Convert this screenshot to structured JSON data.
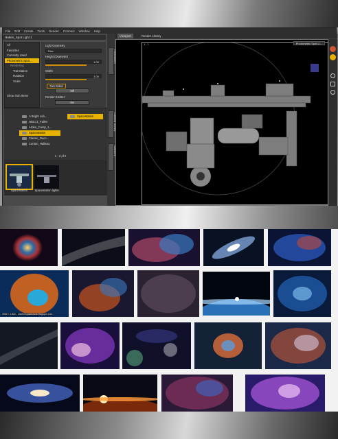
{
  "menu": [
    "File",
    "Edit",
    "Create",
    "Tools",
    "Render",
    "Connect",
    "Window",
    "Help"
  ],
  "left_panel": {
    "node_dropdown": "Hatten_Spot Light 1",
    "tree_items": [
      "All",
      "Favorites",
      "Currently Used",
      "Photometric Spot...",
      "Rendering",
      "Translation",
      "Rotation",
      "Scale",
      "Show Sub Items"
    ],
    "selected_tree_item": "Photometric Spot...",
    "properties": {
      "light_geometry_label": "Light Geometry",
      "light_geometry_value": "Disc",
      "height_label": "Height (Diameter)",
      "height_value": "1.00",
      "width_label": "Width",
      "width_value": "1.00",
      "two_sided_label": "Two Sided",
      "two_sided_value": "Off",
      "render_emitter_label": "Render Emitter",
      "render_emitter_value": "On"
    }
  },
  "side_tabs": [
    "Parameters",
    "Content Library",
    "Surfaces"
  ],
  "library": {
    "folders": [
      "A Bright Lub...",
      "HDLC1_Fallen",
      "Arden_Camp_1...",
      "Spacestation",
      "Classic_Deco...",
      "Curtain_Hallway"
    ],
    "selected_folder": "Spacestation",
    "right_list": [
      "Spacestation"
    ],
    "page_label": "1 - 2 of 2",
    "thumbnails": [
      "Spacestation",
      "Spacestation lights"
    ],
    "selected_thumbnail": "Spacestation"
  },
  "viewport": {
    "tabs": [
      "Viewport",
      "Render Library"
    ],
    "active_tab": "Viewport",
    "camera": "Photometric Spot Li...",
    "corner_label": "1 : 1"
  },
  "gallery": {
    "caption": "2560 × 1600 – starthespacecircle.blogspot.com"
  },
  "colors": {
    "accent": "#e8b300",
    "panel": "#4a4a4a",
    "dark": "#2e2e2e"
  }
}
